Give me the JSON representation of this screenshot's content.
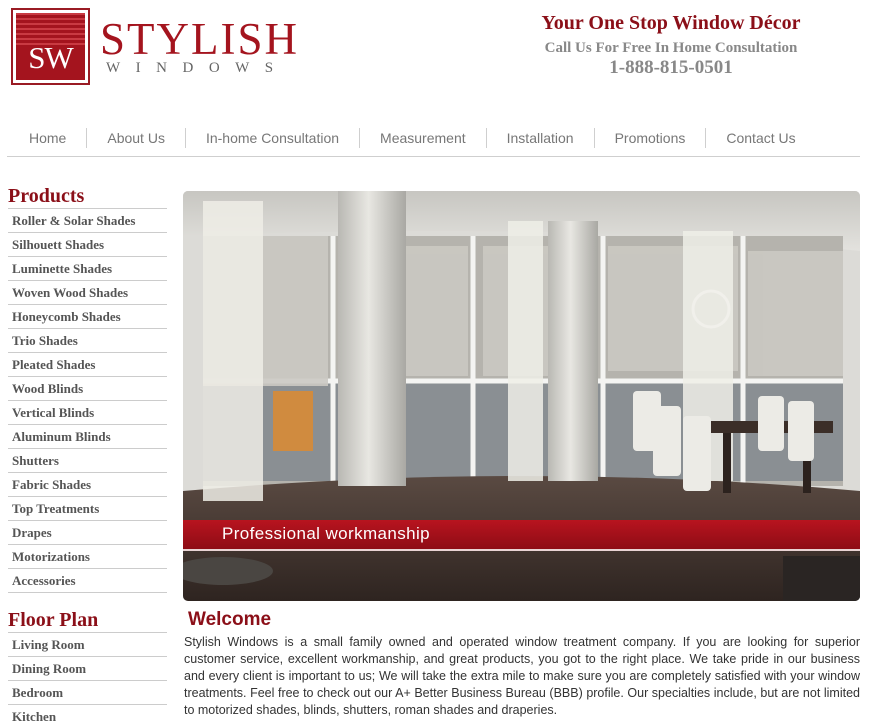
{
  "brand": {
    "logo_initials": "SW",
    "name": "STYLISH",
    "sub": "WINDOWS",
    "color": "#a4141e"
  },
  "header": {
    "tagline": "Your One Stop Window Décor",
    "consult": "Call Us For Free In Home Consultation",
    "phone": "1-888-815-0501"
  },
  "nav": [
    "Home",
    "About Us",
    "In-home Consultation",
    "Measurement",
    "Installation",
    "Promotions",
    "Contact Us"
  ],
  "sidebar": {
    "products_heading": "Products",
    "products": [
      "Roller & Solar Shades",
      "Silhouett Shades",
      "Luminette Shades",
      "Woven Wood Shades",
      "Honeycomb Shades",
      "Trio Shades",
      "Pleated Shades",
      "Wood Blinds",
      "Vertical Blinds",
      "Aluminum Blinds",
      "Shutters",
      "Fabric Shades",
      "Top Treatments",
      "Drapes",
      "Motorizations",
      "Accessories"
    ],
    "floorplan_heading": "Floor Plan",
    "floorplan": [
      "Living Room",
      "Dining Room",
      "Bedroom",
      "Kitchen"
    ]
  },
  "hero": {
    "caption": "Professional workmanship"
  },
  "welcome": {
    "title": "Welcome",
    "text": "Stylish Windows is a small family owned and operated window treatment company. If you are looking for superior customer service, excellent workmanship, and great products, you got to the right place. We take pride in our business and every client is important to us; We will take the extra mile to make sure you are completely satisfied with your window treatments. Feel free to check out our A+ Better Business Bureau (BBB) profile. Our specialties include, but are not limited to motorized shades, blinds, shutters, roman shades and draperies."
  }
}
